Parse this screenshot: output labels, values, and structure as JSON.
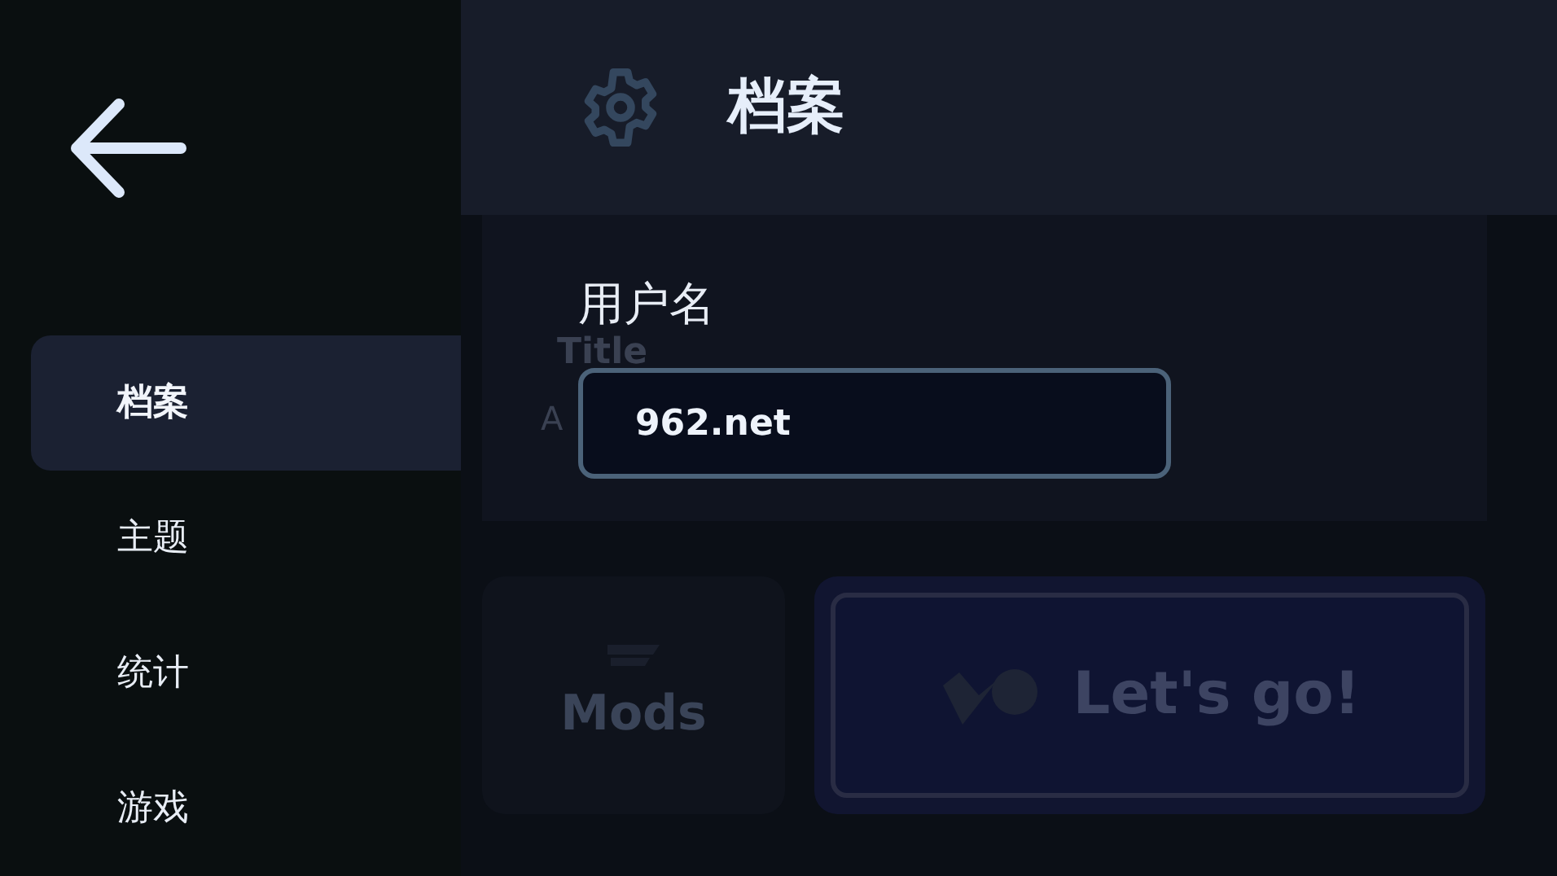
{
  "sidebar": {
    "items": [
      {
        "label": "档案",
        "selected": true
      },
      {
        "label": "主题",
        "selected": false
      },
      {
        "label": "统计",
        "selected": false
      },
      {
        "label": "游戏",
        "selected": false
      }
    ]
  },
  "header": {
    "title": "档案"
  },
  "profile": {
    "label": "用户名",
    "value": "962.net"
  },
  "background": {
    "title": "Title",
    "subtitle": "A",
    "mods": "Mods",
    "play": "Let's go!"
  }
}
